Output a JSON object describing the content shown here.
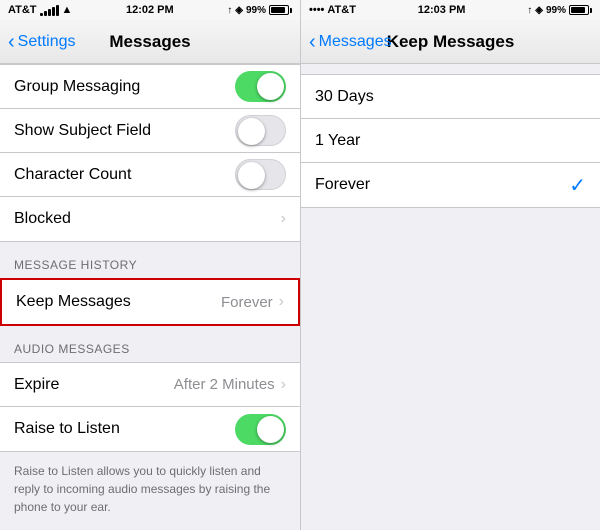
{
  "left": {
    "statusBar": {
      "carrier": "AT&T",
      "time": "12:02 PM",
      "battery": "99%"
    },
    "navBar": {
      "backLabel": "Settings",
      "title": "Messages"
    },
    "rows": [
      {
        "id": "group-messaging",
        "label": "Group Messaging",
        "type": "toggle",
        "value": true
      },
      {
        "id": "show-subject-field",
        "label": "Show Subject Field",
        "type": "toggle",
        "value": false
      },
      {
        "id": "character-count",
        "label": "Character Count",
        "type": "toggle",
        "value": false
      },
      {
        "id": "blocked",
        "label": "Blocked",
        "type": "chevron"
      }
    ],
    "messageHistorySection": {
      "header": "MESSAGE HISTORY",
      "rows": [
        {
          "id": "keep-messages",
          "label": "Keep Messages",
          "value": "Forever",
          "type": "chevron"
        }
      ]
    },
    "audioMessagesSection": {
      "header": "AUDIO MESSAGES",
      "rows": [
        {
          "id": "expire",
          "label": "Expire",
          "value": "After 2 Minutes",
          "type": "chevron"
        },
        {
          "id": "raise-to-listen",
          "label": "Raise to Listen",
          "type": "toggle",
          "value": true
        }
      ]
    },
    "description": "Raise to Listen allows you to quickly listen and reply to incoming audio messages by raising the phone to your ear."
  },
  "right": {
    "statusBar": {
      "carrier": "AT&T",
      "time": "12:03 PM",
      "battery": "99%"
    },
    "navBar": {
      "backLabel": "Messages",
      "title": "Keep Messages"
    },
    "options": [
      {
        "id": "30-days",
        "label": "30 Days",
        "selected": false
      },
      {
        "id": "1-year",
        "label": "1 Year",
        "selected": false
      },
      {
        "id": "forever",
        "label": "Forever",
        "selected": true
      }
    ]
  }
}
